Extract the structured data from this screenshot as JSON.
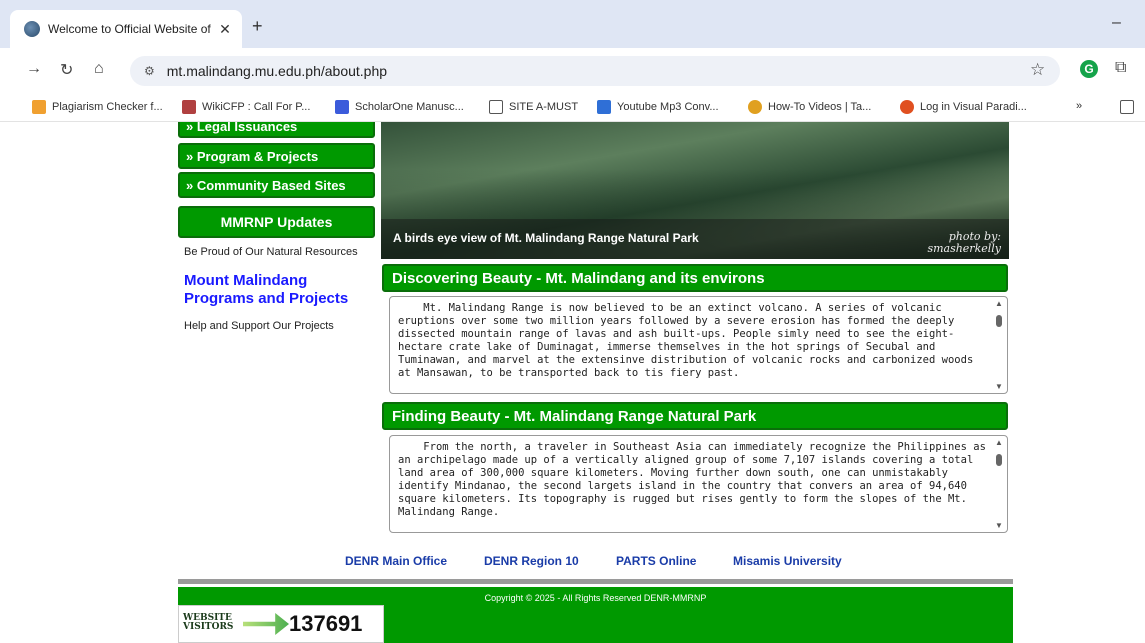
{
  "browser": {
    "tab_title": "Welcome to Official Website of",
    "tab_close": "✕",
    "new_tab": "+",
    "minimize": "–",
    "url": "mt.malindang.mu.edu.ph/about.php",
    "bookmarks": [
      {
        "label": "Plagiarism Checker f...",
        "color": "#f0a030"
      },
      {
        "label": "WikiCFP : Call For P...",
        "color": "#b04040"
      },
      {
        "label": "ScholarOne Manusc...",
        "color": "#3b5bdb"
      },
      {
        "label": "SITE A-MUST",
        "color": "#555555"
      },
      {
        "label": "Youtube Mp3 Conv...",
        "color": "#2f6fd6"
      },
      {
        "label": "How-To Videos | Ta...",
        "color": "#e0a020"
      },
      {
        "label": "Log in Visual Paradi...",
        "color": "#e05020"
      }
    ],
    "bookmarks_more": "»"
  },
  "sidebar": {
    "items": [
      {
        "label": "» Legal Issuances"
      },
      {
        "label": "» Program & Projects"
      },
      {
        "label": "» Community Based Sites"
      }
    ],
    "updates_heading": "MMRNP Updates",
    "proud_text": "Be Proud of Our Natural Resources",
    "programs_link": "Mount Malindang Programs and Projects",
    "help_text": "Help and Support Our Projects"
  },
  "hero": {
    "caption": "A birds eye view of Mt. Malindang Range Natural Park",
    "credit_line1": "photo by:",
    "credit_line2": "smasherkelly"
  },
  "sections": [
    {
      "title": "Discovering Beauty - Mt. Malindang and its environs",
      "body": "    Mt. Malindang Range is now believed to be an extinct volcano. A series of volcanic eruptions over some two million years followed by a severe erosion has formed the deeply dissected mountain range of lavas and ash built-ups. People simly need to see the eight-hectare crate lake of Duminagat, immerse themselves in the hot springs of Secubal and Tuminawan, and marvel at the extensinve distribution of volcanic rocks and carbonized woods at Mansawan, to be transported back to tis fiery past."
    },
    {
      "title": "Finding Beauty - Mt. Malindang Range Natural Park",
      "body": "    From the north, a traveler in Southeast Asia can immediately recognize the Philippines as an archipelago made up of a vertically aligned group of some 7,107 islands covering a total land area of 300,000 square kilometers. Moving further down south, one can unmistakably identify Mindanao, the second largets island in the country that convers an area of 94,640 square kilometers. Its topography is rugged but rises gently to form the slopes of the Mt. Malindang Range."
    }
  ],
  "footer": {
    "links": [
      "DENR Main Office",
      "DENR Region 10",
      "PARTS Online",
      "Misamis University"
    ],
    "copyright": "Copyright © 2025 - All Rights Reserved DENR-MMRNP",
    "visitors_label_1": "WEBSITE",
    "visitors_label_2": "VISITORS",
    "visitors_count": "137691"
  }
}
